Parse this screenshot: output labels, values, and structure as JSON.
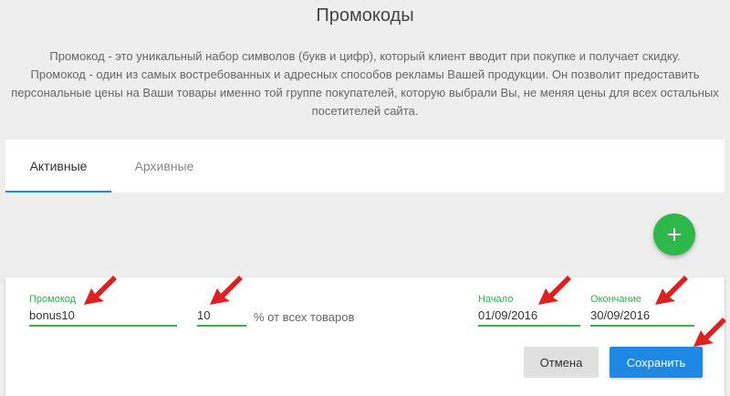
{
  "page": {
    "title": "Промокоды",
    "description_lines": [
      "Промокод - это уникальный набор символов (букв и цифр), который клиент вводит при покупке и получает скидку.",
      "Промокод - один из самых востребованных и адресных способов рекламы Вашей продукции. Он позволит предоставить",
      "персональные цены на Ваши товары именно той группе покупателей, которую выбрали Вы, не меняя цены для всех остальных",
      "посетителей сайта."
    ]
  },
  "tabs": [
    {
      "label": "Активные",
      "active": true
    },
    {
      "label": "Архивные",
      "active": false
    }
  ],
  "fab": {
    "icon": "plus-icon"
  },
  "form": {
    "promo": {
      "label": "Промокод",
      "value": "bonus10"
    },
    "discount": {
      "value": "10",
      "suffix": "% от всех товаров"
    },
    "start": {
      "label": "Начало",
      "value": "01/09/2016"
    },
    "end": {
      "label": "Окончание",
      "value": "30/09/2016"
    },
    "cancel_label": "Отмена",
    "save_label": "Сохранить"
  },
  "colors": {
    "accent_green": "#2fb84a",
    "accent_blue": "#1e88e5",
    "annotation_red": "#e02020"
  }
}
